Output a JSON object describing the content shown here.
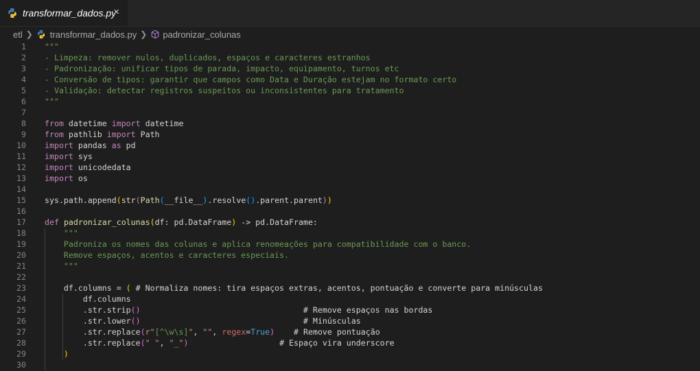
{
  "tab": {
    "label": "transformar_dados.py",
    "close": "×"
  },
  "breadcrumb": {
    "folder": "etl",
    "file": "transformar_dados.py",
    "symbol": "padronizar_colunas"
  },
  "editor": {
    "lines": [
      {
        "n": "1",
        "t": [
          [
            "\"\"\"",
            "c-doc"
          ]
        ]
      },
      {
        "n": "2",
        "t": [
          [
            "- Limpeza: remover nulos, duplicados, espaços e caracteres estranhos",
            "c-doc"
          ]
        ]
      },
      {
        "n": "3",
        "t": [
          [
            "- Padronização: unificar tipos de parada, impacto, equipamento, turnos etc",
            "c-doc"
          ]
        ]
      },
      {
        "n": "4",
        "t": [
          [
            "- Conversão de tipos: garantir que campos como Data e Duração estejam no formato certo",
            "c-doc"
          ]
        ]
      },
      {
        "n": "5",
        "t": [
          [
            "- Validação: detectar registros suspeitos ou inconsistentes para tratamento",
            "c-doc"
          ]
        ]
      },
      {
        "n": "6",
        "t": [
          [
            "\"\"\"",
            "c-doc"
          ]
        ]
      },
      {
        "n": "7",
        "t": []
      },
      {
        "n": "8",
        "t": [
          [
            "from",
            "c-kw"
          ],
          [
            " datetime ",
            "c-txt"
          ],
          [
            "import",
            "c-kw"
          ],
          [
            " datetime",
            "c-txt"
          ]
        ]
      },
      {
        "n": "9",
        "t": [
          [
            "from",
            "c-kw"
          ],
          [
            " pathlib ",
            "c-txt"
          ],
          [
            "import",
            "c-kw"
          ],
          [
            " Path",
            "c-txt"
          ]
        ]
      },
      {
        "n": "10",
        "t": [
          [
            "import",
            "c-kw"
          ],
          [
            " pandas ",
            "c-txt"
          ],
          [
            "as",
            "c-kw"
          ],
          [
            " pd",
            "c-txt"
          ]
        ]
      },
      {
        "n": "11",
        "t": [
          [
            "import",
            "c-kw"
          ],
          [
            " sys",
            "c-txt"
          ]
        ]
      },
      {
        "n": "12",
        "t": [
          [
            "import",
            "c-kw"
          ],
          [
            " unicodedata",
            "c-txt"
          ]
        ]
      },
      {
        "n": "13",
        "t": [
          [
            "import",
            "c-kw"
          ],
          [
            " os",
            "c-txt"
          ]
        ]
      },
      {
        "n": "14",
        "t": []
      },
      {
        "n": "15",
        "t": [
          [
            "sys.path.",
            "c-txt"
          ],
          [
            "append",
            "c-txt"
          ],
          [
            "(",
            "c-p1"
          ],
          [
            "str",
            "c-fn"
          ],
          [
            "(",
            "c-p2"
          ],
          [
            "Path",
            "c-fn"
          ],
          [
            "(",
            "c-p3"
          ],
          [
            "__file__",
            "c-txt"
          ],
          [
            ")",
            "c-p3"
          ],
          [
            ".resolve",
            "c-txt"
          ],
          [
            "()",
            "c-p3"
          ],
          [
            ".parent.parent",
            "c-txt"
          ],
          [
            ")",
            "c-p2"
          ],
          [
            ")",
            "c-p1"
          ]
        ]
      },
      {
        "n": "16",
        "t": []
      },
      {
        "n": "17",
        "t": [
          [
            "def",
            "c-kw"
          ],
          [
            " ",
            "c-txt"
          ],
          [
            "padronizar_colunas",
            "c-fn"
          ],
          [
            "(",
            "c-p1"
          ],
          [
            "df",
            "c-txt"
          ],
          [
            ": pd.DataFrame",
            "c-txt"
          ],
          [
            ")",
            "c-p1"
          ],
          [
            " -> pd.DataFrame:",
            "c-txt"
          ]
        ]
      },
      {
        "n": "18",
        "t": [
          [
            "    \"\"\"",
            "c-doc"
          ]
        ]
      },
      {
        "n": "19",
        "t": [
          [
            "    Padroniza os nomes das colunas e aplica renomeações para compatibilidade com o banco.",
            "c-doc"
          ]
        ]
      },
      {
        "n": "20",
        "t": [
          [
            "    Remove espaços, acentos e caracteres especiais.",
            "c-doc"
          ]
        ]
      },
      {
        "n": "21",
        "t": [
          [
            "    \"\"\"",
            "c-doc"
          ]
        ]
      },
      {
        "n": "22",
        "t": []
      },
      {
        "n": "23",
        "t": [
          [
            "    df.columns = ",
            "c-txt"
          ],
          [
            "(",
            "c-p1"
          ],
          [
            " # Normaliza nomes: tira espaços extras, acentos, pontuação e converte para minúsculas",
            "c-txt"
          ]
        ]
      },
      {
        "n": "24",
        "t": [
          [
            "        df.columns",
            "c-txt"
          ]
        ]
      },
      {
        "n": "25",
        "t": [
          [
            "        .str.strip",
            "c-txt"
          ],
          [
            "()",
            "c-p2"
          ],
          [
            "                                  # Remove espaços nas bordas",
            "c-txt"
          ]
        ]
      },
      {
        "n": "26",
        "t": [
          [
            "        .str.lower",
            "c-txt"
          ],
          [
            "()",
            "c-p2"
          ],
          [
            "                                  # Minúsculas",
            "c-txt"
          ]
        ]
      },
      {
        "n": "27",
        "t": [
          [
            "        .str.replace",
            "c-txt"
          ],
          [
            "(",
            "c-p2"
          ],
          [
            "r\"",
            "c-str"
          ],
          [
            "[^\\w\\s]",
            "c-cmt"
          ],
          [
            "\"",
            "c-str"
          ],
          [
            ", ",
            "c-txt"
          ],
          [
            "\"\"",
            "c-str"
          ],
          [
            ", ",
            "c-txt"
          ],
          [
            "regex",
            "c-regex"
          ],
          [
            "=",
            "c-txt"
          ],
          [
            "True",
            "c-kw2"
          ],
          [
            ")",
            "c-p2"
          ],
          [
            "    # Remove pontuação",
            "c-txt"
          ]
        ]
      },
      {
        "n": "28",
        "t": [
          [
            "        .str.replace",
            "c-txt"
          ],
          [
            "(",
            "c-p2"
          ],
          [
            "\" \"",
            "c-str"
          ],
          [
            ", ",
            "c-txt"
          ],
          [
            "\"_\"",
            "c-str"
          ],
          [
            ")",
            "c-p2"
          ],
          [
            "                   # Espaço vira underscore",
            "c-txt"
          ]
        ]
      },
      {
        "n": "29",
        "t": [
          [
            "    ",
            "c-txt"
          ],
          [
            ")",
            "c-p1"
          ]
        ]
      },
      {
        "n": "30",
        "t": []
      }
    ]
  }
}
